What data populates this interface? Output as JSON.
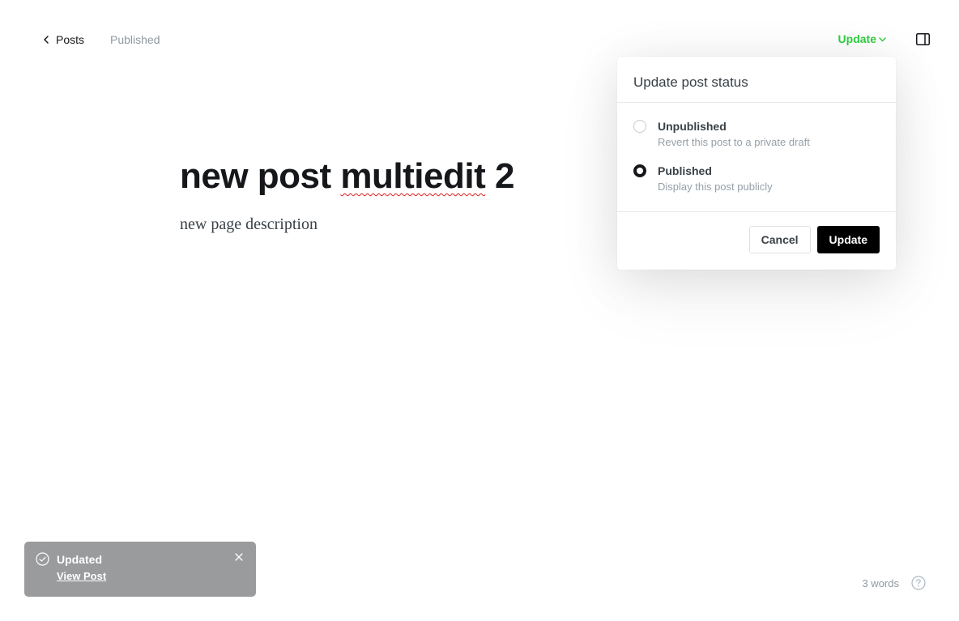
{
  "header": {
    "back_label": "Posts",
    "post_status": "Published",
    "update_label": "Update",
    "icons": {
      "back": "chevron-left-icon",
      "dropdown": "chevron-down-icon",
      "settings": "sidebar-toggle-icon"
    },
    "accent_color": "#30cf43"
  },
  "editor": {
    "title_plain": "new post ",
    "title_misspelled": "multiedit",
    "title_rest": " 2",
    "excerpt": "new page description"
  },
  "status_menu": {
    "heading": "Update post status",
    "options": [
      {
        "label": "Unpublished",
        "description": "Revert this post to a private draft",
        "selected": false
      },
      {
        "label": "Published",
        "description": "Display this post publicly",
        "selected": true
      }
    ],
    "cancel_label": "Cancel",
    "confirm_label": "Update"
  },
  "toast": {
    "title": "Updated",
    "link_label": "View Post",
    "icon": "check-circle-icon",
    "close_icon": "close-icon"
  },
  "footer": {
    "word_count": "3 words",
    "help_icon": "help-circle-icon"
  }
}
